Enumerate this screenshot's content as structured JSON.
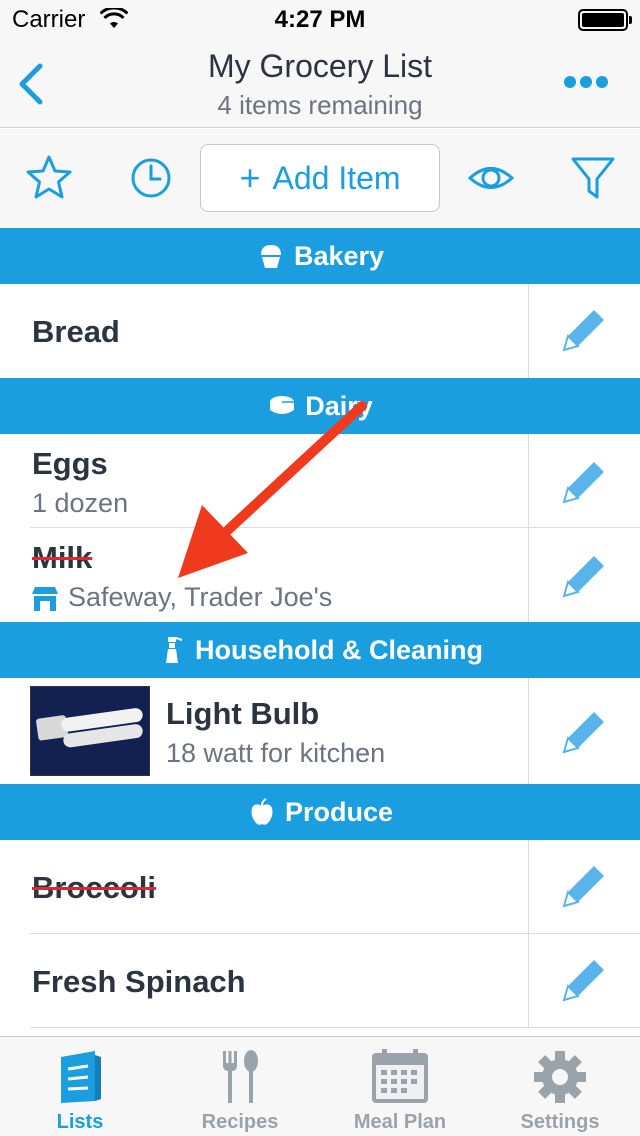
{
  "status_bar": {
    "carrier": "Carrier",
    "time": "4:27 PM"
  },
  "nav": {
    "title": "My Grocery List",
    "subtitle": "4 items remaining"
  },
  "toolbar": {
    "add_item_label": "Add Item"
  },
  "sections": {
    "bakery": {
      "label": "Bakery"
    },
    "dairy": {
      "label": "Dairy"
    },
    "household": {
      "label": "Household & Cleaning"
    },
    "produce": {
      "label": "Produce"
    }
  },
  "items": {
    "bread": {
      "title": "Bread"
    },
    "eggs": {
      "title": "Eggs",
      "note": "1 dozen"
    },
    "milk": {
      "title": "Milk",
      "stores": "Safeway, Trader Joe's",
      "crossed_out": true
    },
    "light_bulb": {
      "title": "Light Bulb",
      "note": "18 watt for kitchen"
    },
    "broccoli": {
      "title": "Broccoli",
      "crossed_out": true
    },
    "spinach": {
      "title": "Fresh Spinach"
    }
  },
  "tabs": [
    {
      "label": "Lists",
      "icon": "lists-icon",
      "active": true
    },
    {
      "label": "Recipes",
      "icon": "fork-spoon-icon",
      "active": false
    },
    {
      "label": "Meal Plan",
      "icon": "calendar-icon",
      "active": false
    },
    {
      "label": "Settings",
      "icon": "gear-icon",
      "active": false
    }
  ],
  "colors": {
    "accent": "#1a9ee0",
    "strike": "#e0262e",
    "annotation_arrow": "#f03a1e"
  }
}
